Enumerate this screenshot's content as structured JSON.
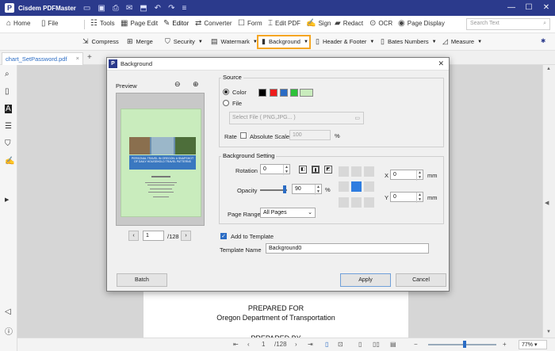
{
  "app": {
    "title": "Cisdem PDFMaster",
    "logo_letter": "P",
    "window_controls": [
      "—",
      "☐",
      "✕"
    ]
  },
  "main_toolbar": {
    "home": "Home",
    "file": "File",
    "tools": "Tools",
    "page_edit": "Page Edit",
    "editor": "Editor",
    "converter": "Converter",
    "form": "Form",
    "edit_pdf": "Edit PDF",
    "sign": "Sign",
    "redact": "Redact",
    "ocr": "OCR",
    "page_display": "Page Display",
    "search_placeholder": "Search Text"
  },
  "sub_toolbar": {
    "compress": "Compress",
    "merge": "Merge",
    "security": "Security",
    "watermark": "Watermark",
    "background": "Background",
    "header_footer": "Header & Footer",
    "bates_numbers": "Bates Numbers",
    "measure": "Measure"
  },
  "tab": {
    "name": "chart_SetPassword.pdf",
    "close": "×",
    "new": "+"
  },
  "document": {
    "line1": "PREPARED FOR",
    "line2": "Oregon Department of Transportation",
    "line3": "PREPARED BY"
  },
  "bottom_bar": {
    "current_page": "1",
    "total_pages": "/128",
    "zoom": "77%"
  },
  "dialog": {
    "title": "Background",
    "preview_label": "Preview",
    "preview_page": "1",
    "preview_total": "/128",
    "preview_doc_title": "PERSONAL TRAVEL IN OREGON: A SNAPSHOT OF DAILY HOUSEHOLD TRAVEL PATTERNS",
    "source_label": "Source",
    "color_label": "Color",
    "file_label": "File",
    "select_file_label": "Select File ( PNG,JPG... )",
    "rate_label": "Rate",
    "absolute_scale_label": "Absolute Scale",
    "rate_value": "100",
    "percent": "%",
    "background_setting_label": "Background Setting",
    "rotation_label": "Rotation",
    "rotation_value": "0",
    "opacity_label": "Opacity",
    "opacity_value": "90",
    "opacity_level": 0.9,
    "page_range_label": "Page Range",
    "page_range_value": "All Pages",
    "x_label": "X",
    "x_value": "0",
    "y_label": "Y",
    "y_value": "0",
    "unit": "mm",
    "add_to_template_label": "Add to Template",
    "add_to_template_checked": true,
    "template_name_label": "Template Name",
    "template_name_value": "Background0",
    "batch_label": "Batch",
    "apply_label": "Apply",
    "cancel_label": "Cancel",
    "swatches": [
      "#000000",
      "#ee1c1c",
      "#2b6cc4",
      "#2ec13a",
      "#c9ecbd"
    ]
  },
  "colors": {
    "title_bar": "#2b3a8c",
    "highlight": "#f5a623",
    "accent": "#2f7de0"
  }
}
